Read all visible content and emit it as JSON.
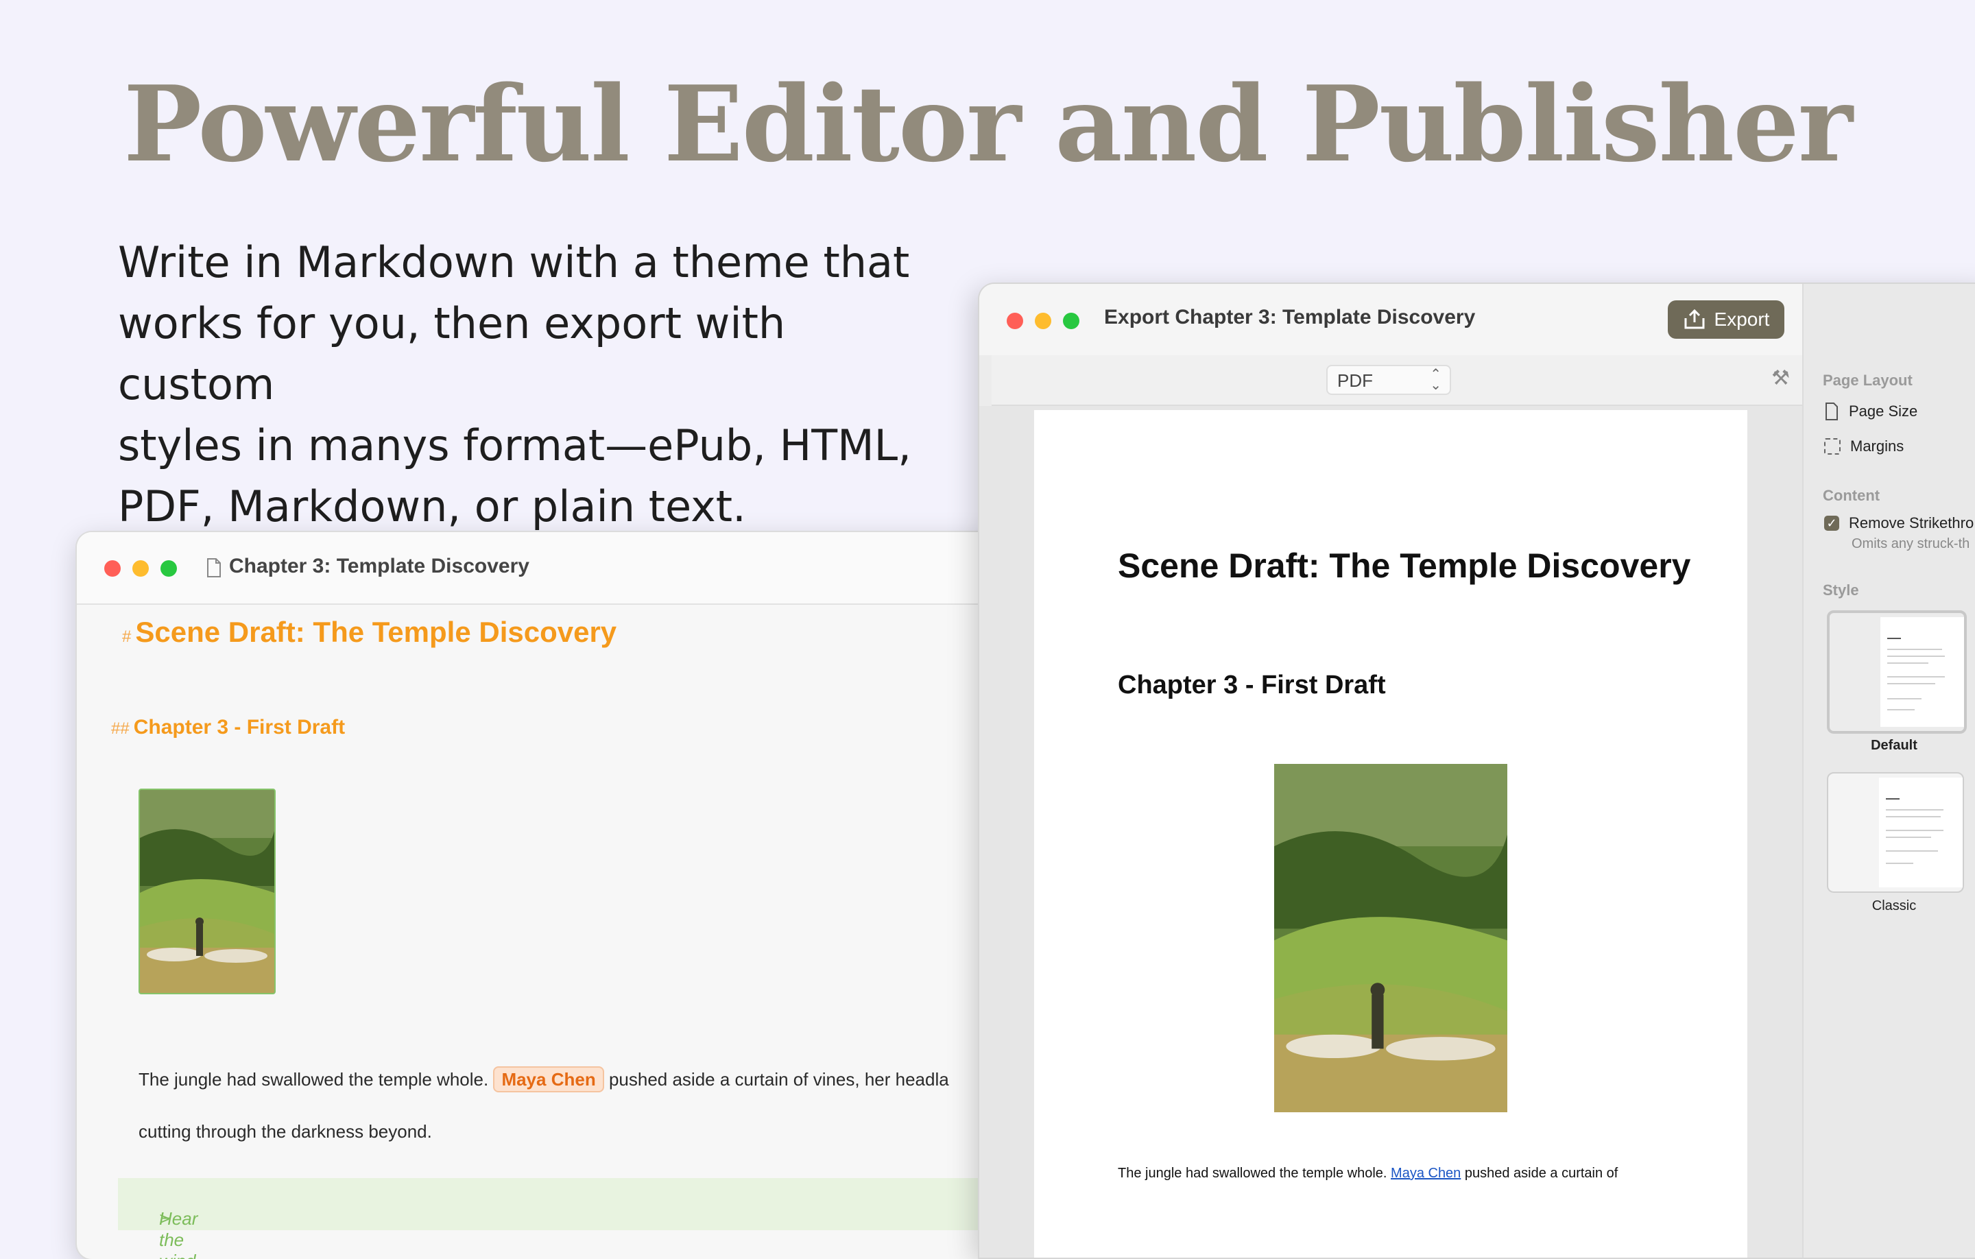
{
  "headline": "Powerful Editor and Publisher",
  "subtitle_lines": [
    "Write in Markdown with a theme that",
    "works for you, then export with custom",
    "styles in manys format—ePub, HTML,",
    "PDF, Markdown, or plain text."
  ],
  "editor": {
    "title": "Chapter 3: Template Discovery",
    "h1_marker": "#",
    "h1": "Scene Draft: The Temple Discovery",
    "h2_marker": "##",
    "h2": "Chapter 3 - First Draft",
    "para_before": "The jungle had swallowed the temple whole.",
    "mention": "Maya Chen",
    "para_after": "pushed aside a curtain of vines, her headla",
    "para_line2": "cutting through the darkness beyond.",
    "quote_marker": ">",
    "quote": "Hear the wind hoel"
  },
  "export_window": {
    "title": "Export Chapter 3: Template Discovery",
    "export_button": "Export",
    "format": "PDF",
    "preview": {
      "h1": "Scene Draft: The Temple Discovery",
      "h2": "Chapter 3 - First Draft",
      "para_before": "The jungle had swallowed the temple whole.",
      "link": "Maya Chen",
      "para_after": "pushed aside a curtain of"
    },
    "sidebar": {
      "page_layout_heading": "Page Layout",
      "page_size": "Page Size",
      "margins": "Margins",
      "content_heading": "Content",
      "remove_strike": "Remove Strikethro",
      "remove_strike_sub": "Omits any struck-th",
      "style_heading": "Style",
      "styles": [
        {
          "label": "Default",
          "selected": true
        },
        {
          "label": "Classic",
          "selected": false
        }
      ]
    }
  },
  "colors": {
    "background": "#f3f2fc",
    "headline": "#928b7c",
    "heading_orange": "#f59a1c",
    "export_button": "#6f6a58",
    "link": "#1a55c4"
  }
}
